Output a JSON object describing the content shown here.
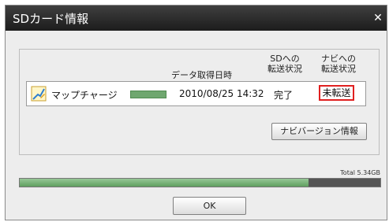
{
  "window": {
    "title": "SDカード情報",
    "close_glyph": "✕"
  },
  "table": {
    "headers": {
      "date": "データ取得日時",
      "sd_status": [
        "SDへの",
        "転送状況"
      ],
      "navi_status": [
        "ナビへの",
        "転送状況"
      ]
    },
    "rows": [
      {
        "icon": "pencil-chart-icon",
        "name": "マップチャージ",
        "date": "2010/08/25 14:32",
        "sd_status": "完了",
        "navi_status": "未転送"
      }
    ]
  },
  "navi_version_button": "ナビバージョン情報",
  "storage": {
    "total_label": "Total 5.34GB",
    "used_fraction": 0.8
  },
  "ok_button": "OK",
  "colors": {
    "highlight": "#e02020",
    "progress": "#6fa76f",
    "titlebar": "#2a2a2a"
  }
}
